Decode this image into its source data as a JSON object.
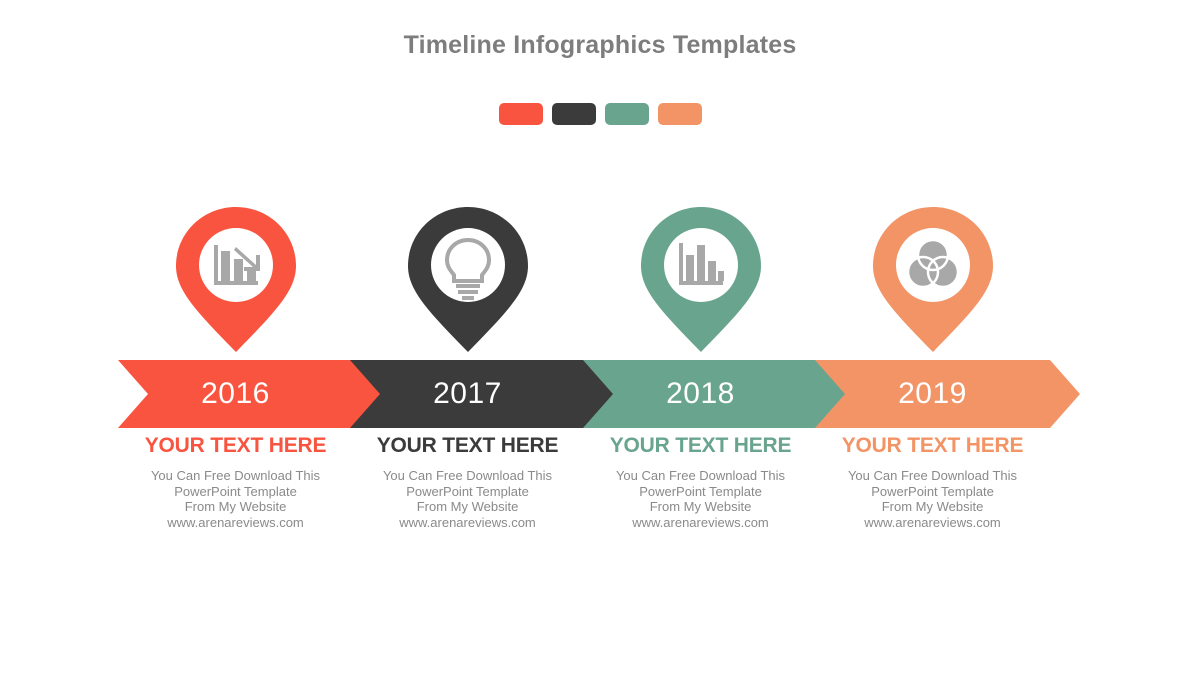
{
  "header": {
    "title": "Timeline Infographics Templates"
  },
  "palette": {
    "swatches": [
      {
        "name": "swatch-red",
        "color": "#f9543f"
      },
      {
        "name": "swatch-dark",
        "color": "#3b3b3b"
      },
      {
        "name": "swatch-teal",
        "color": "#69a48e"
      },
      {
        "name": "swatch-orange",
        "color": "#f29466"
      }
    ]
  },
  "timeline": {
    "items": [
      {
        "year": "2016",
        "color": "#f9543f",
        "icon": "declining-bar-chart-icon",
        "heading": "YOUR TEXT HERE",
        "body_lines": [
          "You Can Free Download This",
          "PowerPoint Template",
          "From My Website",
          "www.arenareviews.com"
        ]
      },
      {
        "year": "2017",
        "color": "#3b3b3b",
        "icon": "lightbulb-icon",
        "heading": "YOUR TEXT HERE",
        "body_lines": [
          "You Can Free Download This",
          "PowerPoint Template",
          "From My Website",
          "www.arenareviews.com"
        ]
      },
      {
        "year": "2018",
        "color": "#69a48e",
        "icon": "bar-chart-icon",
        "heading": "YOUR TEXT HERE",
        "body_lines": [
          "You Can Free Download This",
          "PowerPoint Template",
          "From My Website",
          "www.arenareviews.com"
        ]
      },
      {
        "year": "2019",
        "color": "#f29466",
        "icon": "venn-circles-icon",
        "heading": "YOUR TEXT HERE",
        "body_lines": [
          "You Can Free Download This",
          "PowerPoint Template",
          "From My Website",
          "www.arenareviews.com"
        ]
      }
    ]
  },
  "styles": {
    "title_color": "#7d7d7d",
    "body_text_color": "#8a8a8a",
    "icon_glyph_color": "#a8a8a8",
    "background": "#ffffff"
  }
}
